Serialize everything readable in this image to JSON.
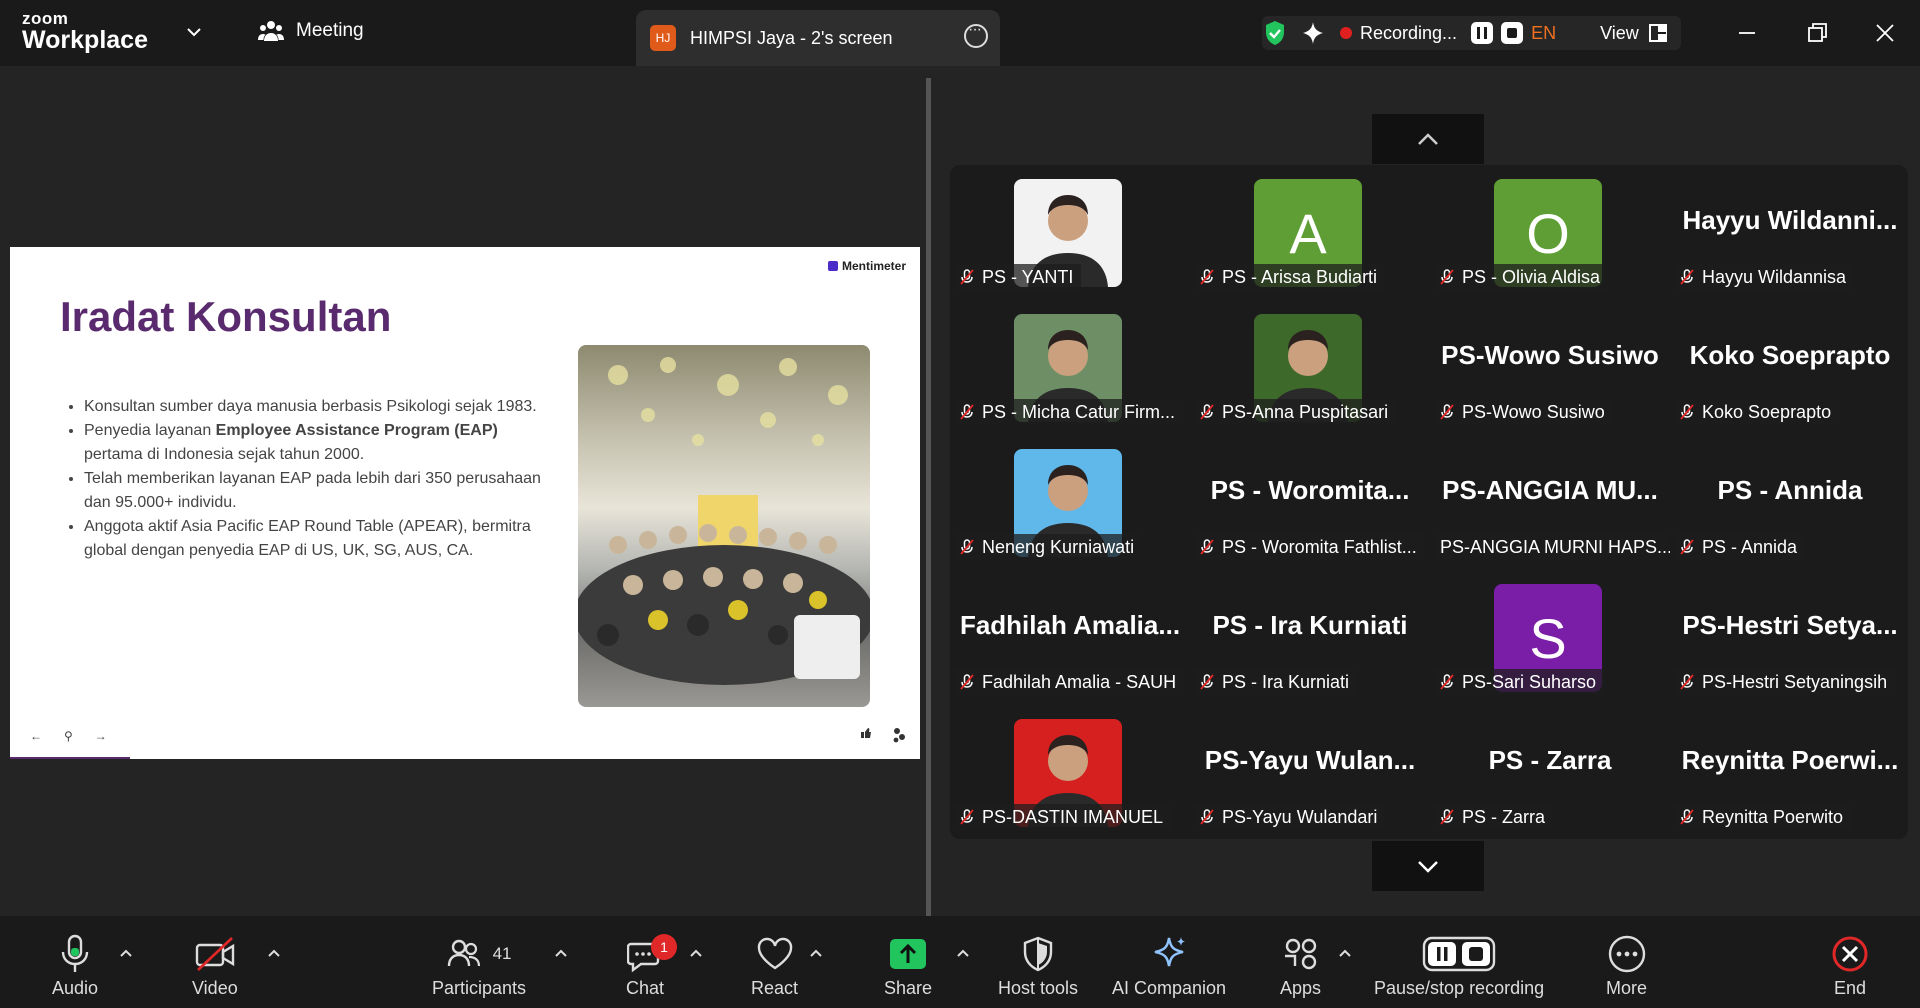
{
  "app": {
    "brand_top": "zoom",
    "brand_bottom": "Workplace"
  },
  "header": {
    "meeting_label": "Meeting",
    "share_tab": {
      "avatar": "HJ",
      "title": "HIMPSI Jaya - 2's screen"
    },
    "recording_label": "Recording...",
    "language": "EN",
    "view_label": "View"
  },
  "slide": {
    "title": "Iradat Konsultan",
    "brand": "Mentimeter",
    "bullets": [
      {
        "before": "Konsultan sumber daya manusia berbasis Psikologi sejak 1983.",
        "bold": "",
        "after": ""
      },
      {
        "before": "Penyedia layanan ",
        "bold": "Employee Assistance Program (EAP)",
        "after": " pertama di Indonesia sejak tahun 2000."
      },
      {
        "before": "Telah memberikan layanan EAP pada lebih dari 350 perusahaan dan 95.000+ individu.",
        "bold": "",
        "after": ""
      },
      {
        "before": "Anggota aktif Asia Pacific EAP Round Table (APEAR), bermitra global dengan penyedia EAP di US, UK, SG, AUS, CA.",
        "bold": "",
        "after": ""
      }
    ],
    "nav": [
      "←",
      "⚲",
      "→"
    ]
  },
  "participants": [
    {
      "name": "PS - YANTI",
      "type": "photo",
      "color": "#f2f2f2"
    },
    {
      "name": "PS - Arissa Budiarti",
      "type": "letter",
      "letter": "A",
      "color": "#5e9e34"
    },
    {
      "name": "PS - Olivia Aldisa",
      "type": "letter",
      "letter": "O",
      "color": "#5e9e34"
    },
    {
      "name": "Hayyu Wildannisa",
      "type": "text",
      "big": "Hayyu  Wildanni..."
    },
    {
      "name": "PS - Micha Catur Firm...",
      "type": "photo",
      "color": "#6e8f66"
    },
    {
      "name": "PS-Anna Puspitasari",
      "type": "photo",
      "color": "#3d6a2a"
    },
    {
      "name": "PS-Wowo Susiwo",
      "type": "text",
      "big": "PS-Wowo Susiwo"
    },
    {
      "name": "Koko Soeprapto",
      "type": "text",
      "big": "Koko Soeprapto"
    },
    {
      "name": "Neneng Kurniawati",
      "type": "photo",
      "color": "#5fb7ea"
    },
    {
      "name": "PS - Woromita Fathlist...",
      "type": "text",
      "big": "PS  -  Woromita..."
    },
    {
      "name": "PS-ANGGIA MURNI HAPS...",
      "type": "text",
      "big": "PS-ANGGIA  MU...",
      "nomic": true
    },
    {
      "name": "PS - Annida",
      "type": "text",
      "big": "PS - Annida"
    },
    {
      "name": "Fadhilah Amalia - SAUH",
      "type": "text",
      "big": "Fadhilah  Amalia..."
    },
    {
      "name": "PS - Ira Kurniati",
      "type": "text",
      "big": "PS - Ira Kurniati"
    },
    {
      "name": "PS-Sari Suharso",
      "type": "letter",
      "letter": "S",
      "color": "#7a1ea8"
    },
    {
      "name": "PS-Hestri Setyaningsih",
      "type": "text",
      "big": "PS-Hestri  Setya..."
    },
    {
      "name": "PS-DASTIN IMANUEL",
      "type": "photo",
      "color": "#d62020"
    },
    {
      "name": "PS-Yayu Wulandari",
      "type": "text",
      "big": "PS-Yayu  Wulan..."
    },
    {
      "name": "PS - Zarra",
      "type": "text",
      "big": "PS - Zarra"
    },
    {
      "name": "Reynitta Poerwito",
      "type": "text",
      "big": "Reynitta  Poerwi..."
    }
  ],
  "toolbar": {
    "audio": "Audio",
    "video": "Video",
    "participants": "Participants",
    "participants_count": "41",
    "chat": "Chat",
    "chat_badge": "1",
    "react": "React",
    "share": "Share",
    "host_tools": "Host tools",
    "ai_companion": "AI Companion",
    "apps": "Apps",
    "pause_recording": "Pause/stop recording",
    "more": "More",
    "end": "End"
  },
  "colors": {
    "share_green": "#21c45d",
    "end_red": "#e02828",
    "accent_orange": "#f07020"
  }
}
